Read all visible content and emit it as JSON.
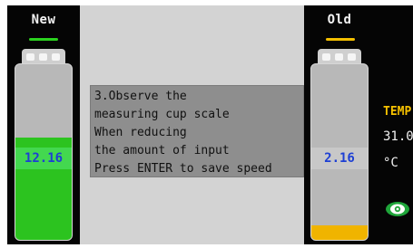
{
  "left_panel": {
    "title": "New",
    "value": "12.16",
    "fill_fraction": 0.58,
    "accent_color": "#2bd21f"
  },
  "message": {
    "lines": [
      "3.Observe the",
      "measuring cup scale",
      "When reducing",
      "the amount of input",
      "Press ENTER to save speed"
    ]
  },
  "right_panel": {
    "title": "Old",
    "value": "2.16",
    "fill_fraction": 0.08,
    "accent_color": "#f3bf00"
  },
  "side_info": {
    "temp_label": "TEMP",
    "temp_value": "31.0",
    "temp_unit": "°C",
    "icon": "eye-icon"
  }
}
